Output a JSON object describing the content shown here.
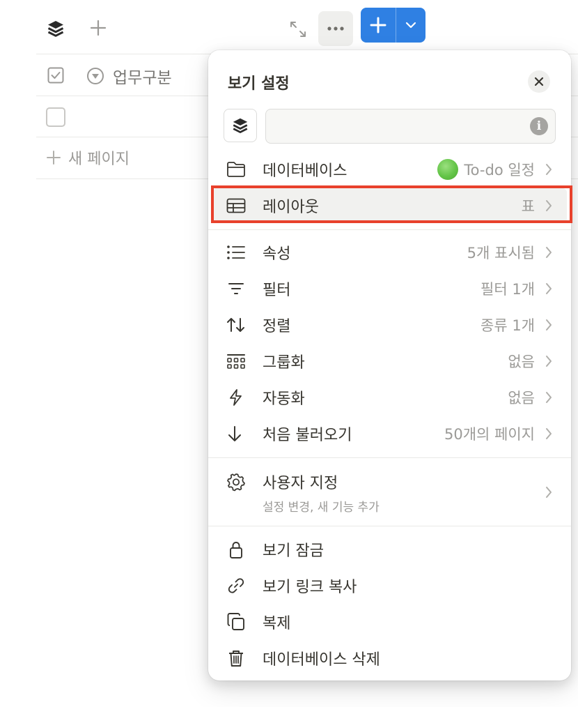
{
  "background": {
    "table_header": {
      "property_label": "업무구분"
    },
    "new_page_label": "새 페이지"
  },
  "menu": {
    "title": "보기 설정",
    "name_input": {
      "value": "",
      "placeholder": ""
    },
    "items": [
      {
        "id": "database",
        "label": "데이터베이스",
        "value": "To-do 일정",
        "icon": "folder-icon"
      },
      {
        "id": "layout",
        "label": "레이아웃",
        "value": "표",
        "icon": "table-icon",
        "highlighted": true
      },
      {
        "id": "properties",
        "label": "속성",
        "value": "5개 표시됨",
        "icon": "list-icon"
      },
      {
        "id": "filter",
        "label": "필터",
        "value": "필터 1개",
        "icon": "filter-icon"
      },
      {
        "id": "sort",
        "label": "정렬",
        "value": "종류 1개",
        "icon": "sort-icon"
      },
      {
        "id": "group",
        "label": "그룹화",
        "value": "없음",
        "icon": "group-icon"
      },
      {
        "id": "automation",
        "label": "자동화",
        "value": "없음",
        "icon": "lightning-icon"
      },
      {
        "id": "load",
        "label": "처음 불러오기",
        "value": "50개의 페이지",
        "icon": "arrow-down-icon"
      }
    ],
    "customize": {
      "label": "사용자 지정",
      "sublabel": "설정 변경, 새 기능 추가",
      "icon": "gear-icon"
    },
    "actions": [
      {
        "id": "lock",
        "label": "보기 잠금",
        "icon": "lock-icon"
      },
      {
        "id": "copy-link",
        "label": "보기 링크 복사",
        "icon": "link-icon"
      },
      {
        "id": "duplicate",
        "label": "복제",
        "icon": "duplicate-icon"
      },
      {
        "id": "delete",
        "label": "데이터베이스 삭제",
        "icon": "trash-icon"
      }
    ]
  },
  "colors": {
    "accent": "#2f80e3",
    "highlight_border": "#e8412c",
    "text_primary": "#37352f",
    "text_secondary": "#9b9a97"
  }
}
